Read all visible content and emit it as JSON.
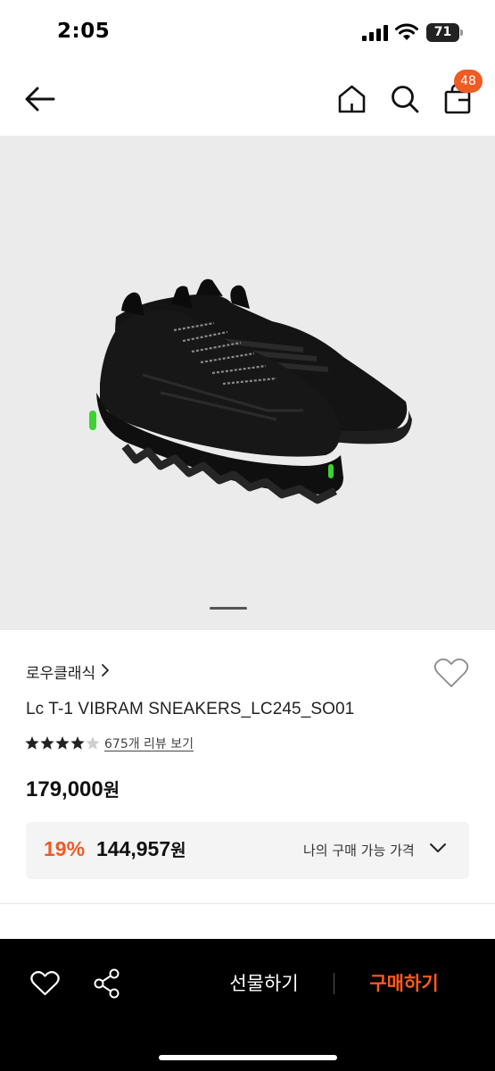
{
  "status_bar": {
    "time": "2:05",
    "battery_level": "71"
  },
  "nav": {
    "cart_count": "48"
  },
  "product": {
    "brand": "로우클래식",
    "name": "Lc T-1 VIBRAM SNEAKERS_LC245_SO01",
    "rating": 4.5,
    "review_link": "675개 리뷰 보기",
    "price_number": "179,000",
    "price_unit": "원",
    "my_price": {
      "discount": "19%",
      "price_number": "144,957",
      "price_unit": "원",
      "label": "나의 구매 가능 가격"
    },
    "image_page": 1
  },
  "bottom_bar": {
    "gift_label": "선물하기",
    "buy_label": "구매하기"
  },
  "colors": {
    "accent": "#f05a23",
    "buy_text": "#ff5a1f",
    "bottom_bar": "#000000",
    "hero_bg": "#ebebeb",
    "shoe_accent": "#39d42f"
  },
  "icons": [
    "back-arrow-icon",
    "home-icon",
    "search-icon",
    "cart-icon",
    "heart-icon",
    "share-icon",
    "chevron-right-icon",
    "chevron-down-icon",
    "star-icon"
  ]
}
